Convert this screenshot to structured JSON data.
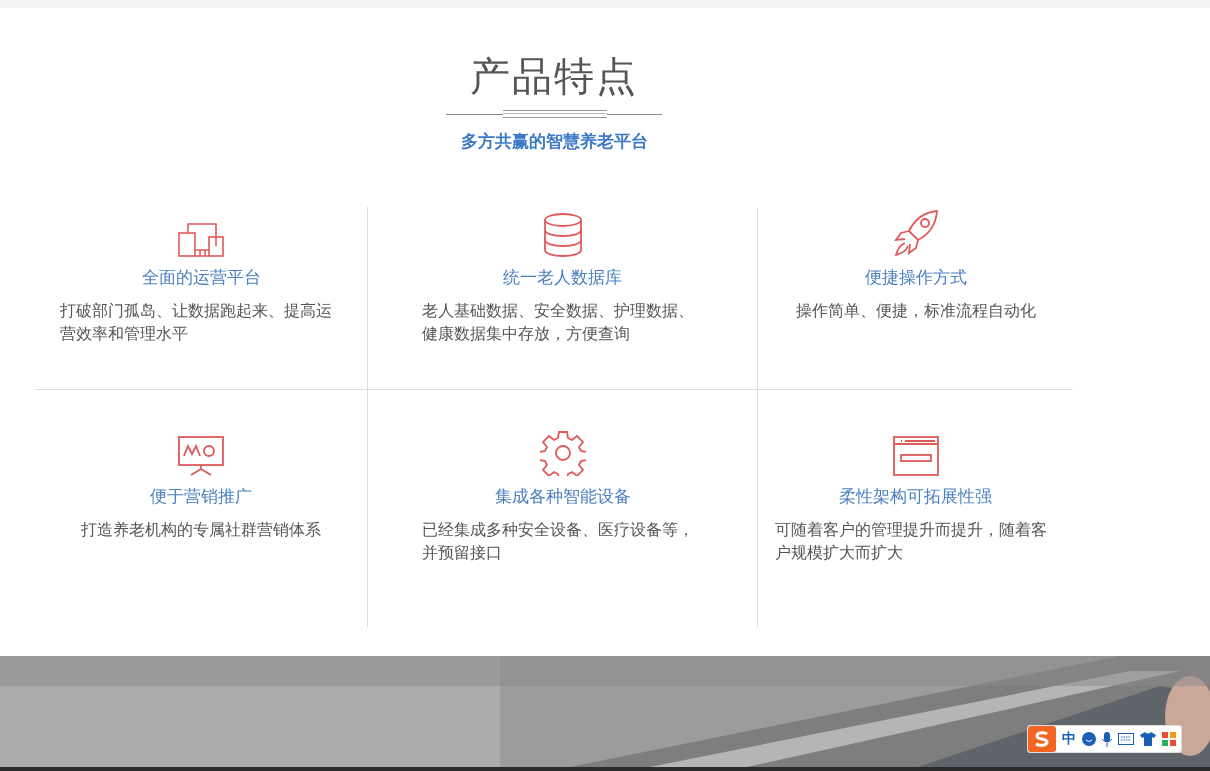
{
  "section": {
    "title": "产品特点",
    "subtitle": "多方共赢的智慧养老平台"
  },
  "features": [
    {
      "title": "全面的运营平台",
      "description": "打破部门孤岛、让数据跑起来、提高运营效率和管理水平"
    },
    {
      "title": "统一老人数据库",
      "description": "老人基础数据、安全数据、护理数据、健康数据集中存放，方便查询"
    },
    {
      "title": "便捷操作方式",
      "description": "操作简单、便捷，标准流程自动化"
    },
    {
      "title": "便于营销推广",
      "description": "打造养老机构的专属社群营销体系"
    },
    {
      "title": "集成各种智能设备",
      "description": "已经集成多种安全设备、医疗设备等，并预留接口"
    },
    {
      "title": "柔性架构可拓展性强",
      "description": "可随着客户的管理提升而提升，随着客户规模扩大而扩大"
    }
  ],
  "ime_toolbar": {
    "mode": "中"
  }
}
